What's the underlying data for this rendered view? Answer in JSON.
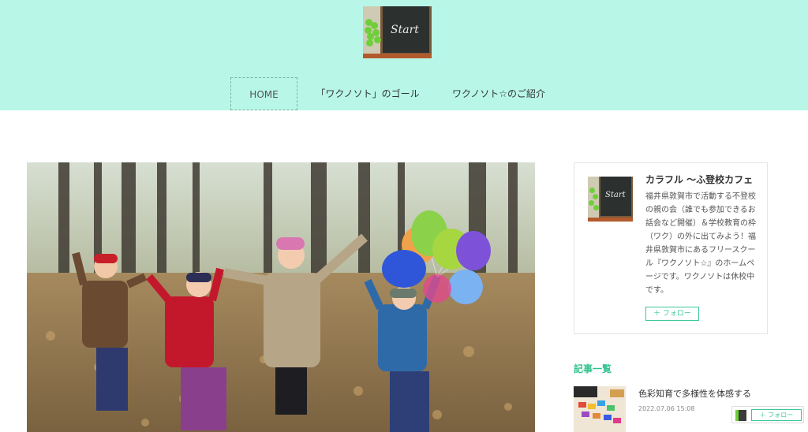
{
  "logo": {
    "board_text": "Start"
  },
  "nav": {
    "items": [
      {
        "label": "HOME"
      },
      {
        "label": "「ワクノソト」のゴール"
      },
      {
        "label": "ワクノソト☆のご紹介"
      }
    ]
  },
  "profile": {
    "name": "カラフル ～ふ登校カフェ",
    "description": "福井県敦賀市で活動する不登校の親の会（誰でも参加できるお話会など開催）＆学校教育の枠（ワク）の外に出てみよう！福井県敦賀市にあるフリースクール『ワクノソト☆』のホームページです。ワクノソトは休校中です。",
    "follow_label": "＋ フォロー"
  },
  "posts": {
    "section_title": "記事一覧",
    "items": [
      {
        "title": "色彩知育で多様性を体感する",
        "date": "2022.07.06 15:08"
      }
    ]
  },
  "floating": {
    "follow_label": "＋ フォロー"
  },
  "colors": {
    "header_bg": "#b8f7e8",
    "accent": "#33c28e"
  }
}
